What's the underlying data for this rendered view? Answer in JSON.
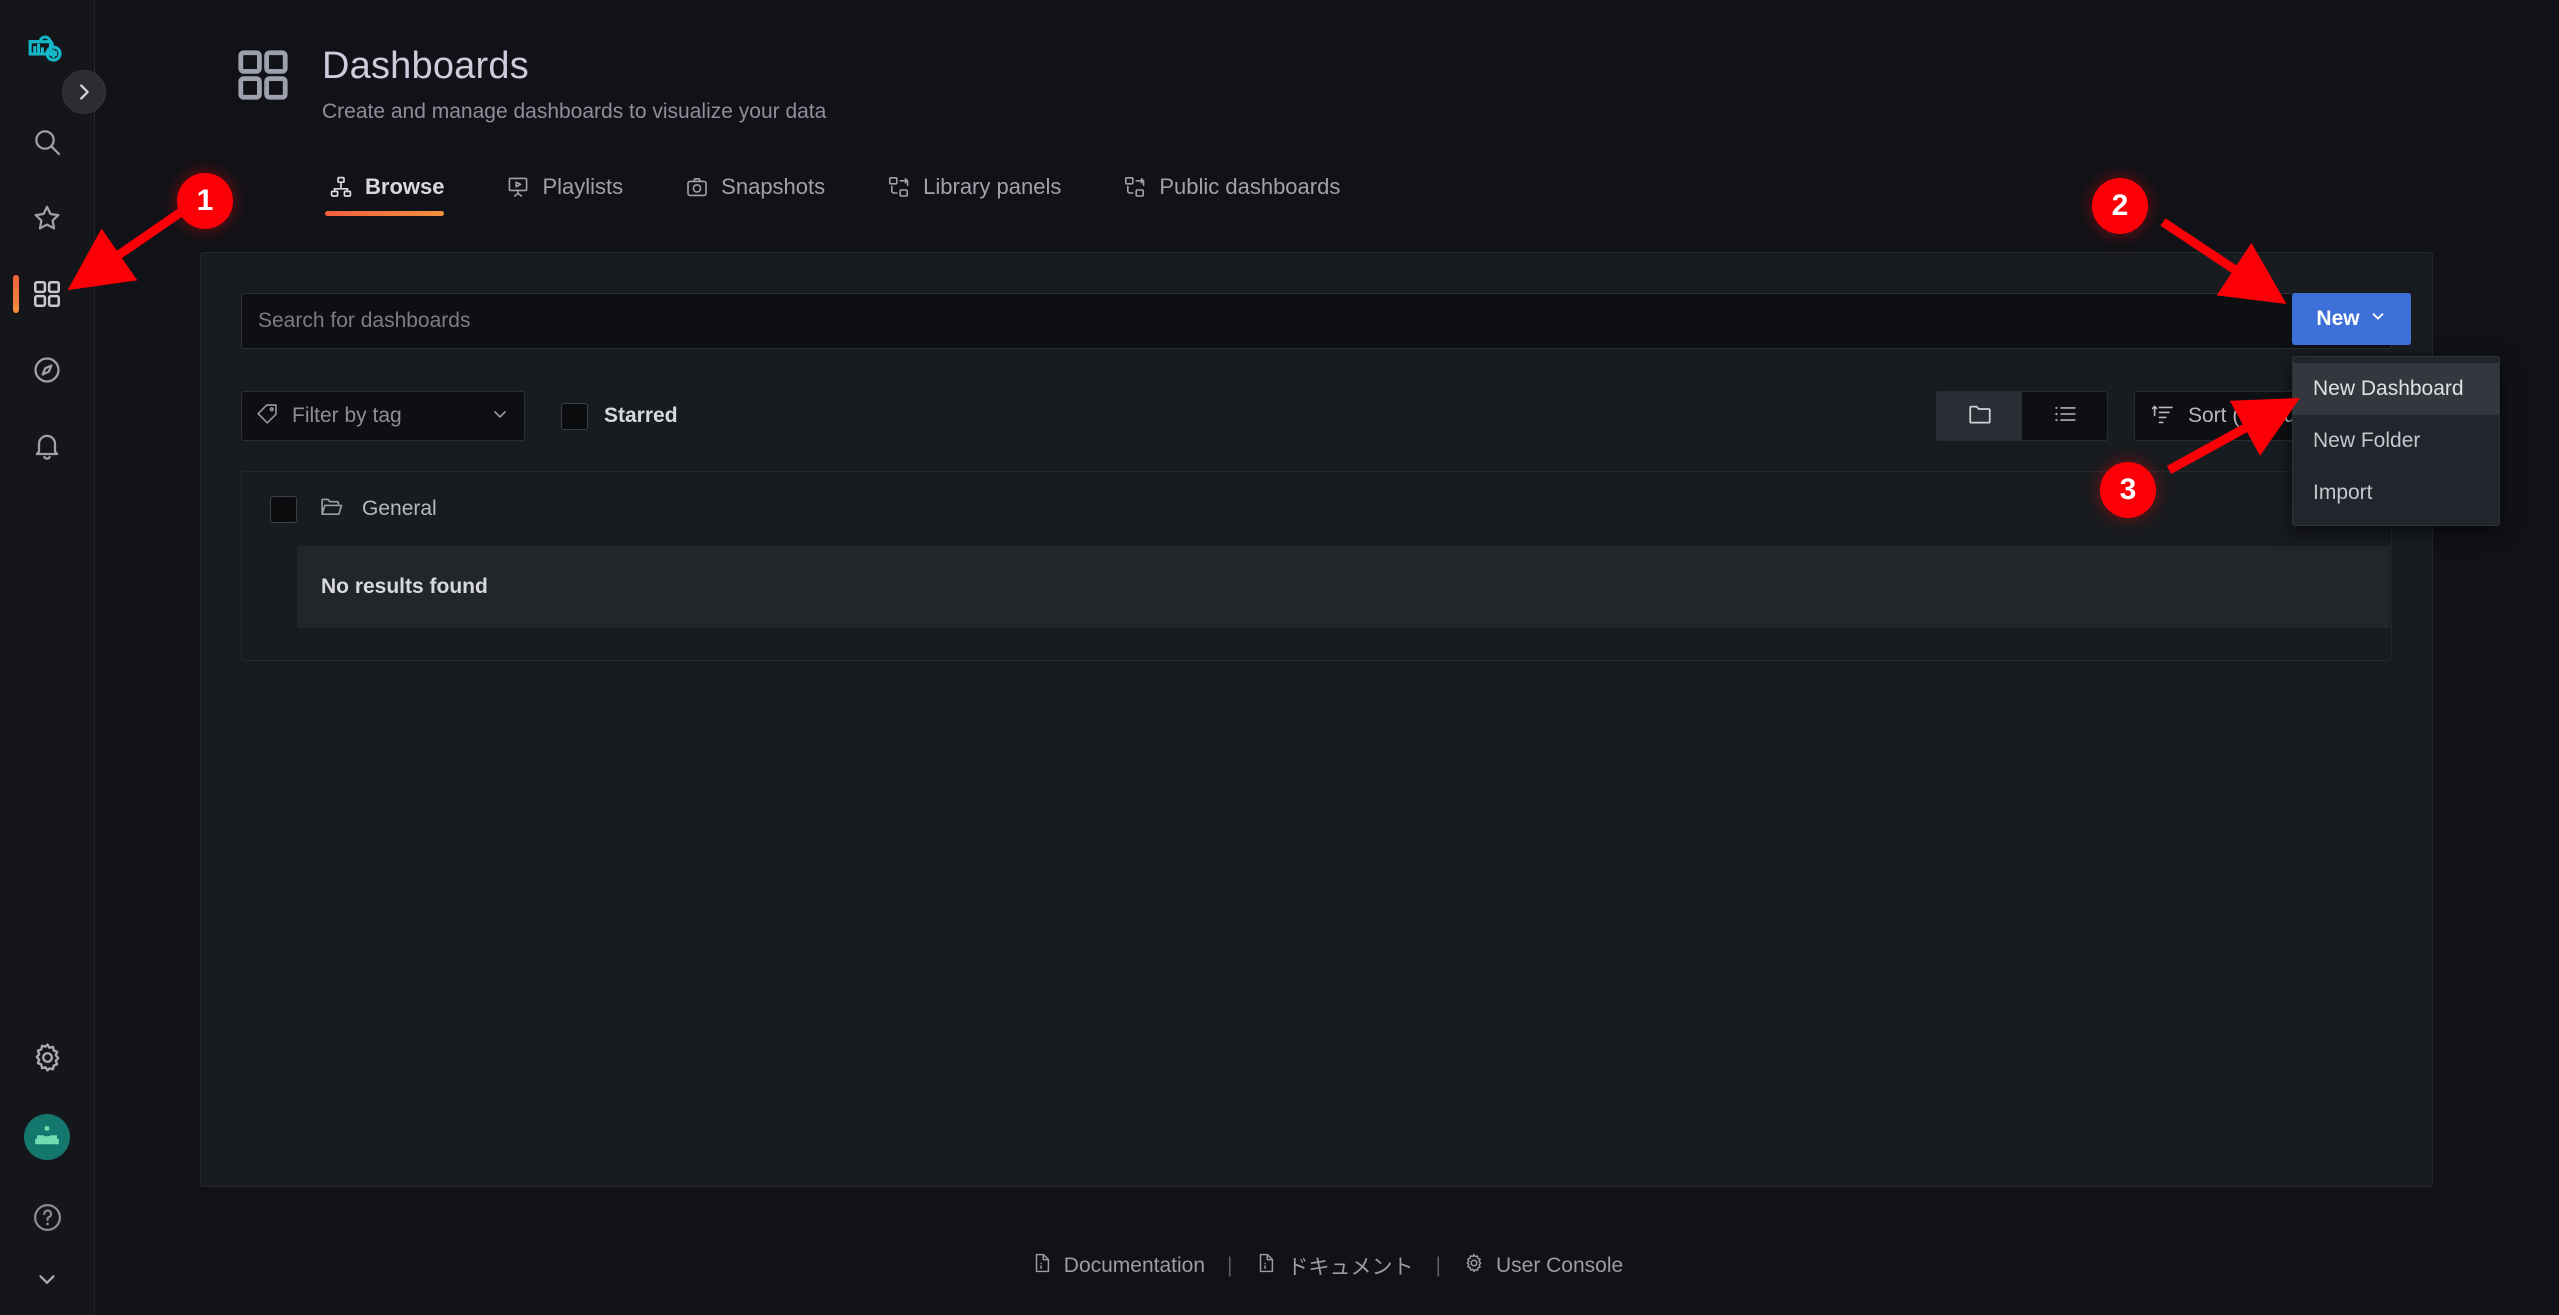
{
  "app": {
    "logo_icon": "grafana-cloud-logo-icon",
    "collapse_icon": "chevron-right-icon"
  },
  "sidebar": {
    "items": [
      {
        "name": "search",
        "icon": "search-icon",
        "active": false
      },
      {
        "name": "starred",
        "icon": "star-icon",
        "active": false
      },
      {
        "name": "dashboards",
        "icon": "dashboards-grid-icon",
        "active": true
      },
      {
        "name": "explore",
        "icon": "compass-icon",
        "active": false
      },
      {
        "name": "alerting",
        "icon": "bell-icon",
        "active": false
      }
    ],
    "bottom_items": [
      {
        "name": "configuration",
        "icon": "gear-icon"
      },
      {
        "name": "user-avatar",
        "icon": "avatar-robot-icon"
      },
      {
        "name": "help",
        "icon": "question-circle-icon"
      },
      {
        "name": "expand",
        "icon": "chevron-down-icon"
      }
    ]
  },
  "header": {
    "icon": "dashboards-grid-icon",
    "title": "Dashboards",
    "subtitle": "Create and manage dashboards to visualize your data"
  },
  "tabs": [
    {
      "label": "Browse",
      "icon": "sitemap-icon",
      "active": true
    },
    {
      "label": "Playlists",
      "icon": "presentation-play-icon",
      "active": false
    },
    {
      "label": "Snapshots",
      "icon": "camera-icon",
      "active": false
    },
    {
      "label": "Library panels",
      "icon": "library-panel-icon",
      "active": false
    },
    {
      "label": "Public dashboards",
      "icon": "library-panel-icon",
      "active": false
    }
  ],
  "search": {
    "placeholder": "Search for dashboards",
    "value": ""
  },
  "new_button": {
    "label": "New",
    "caret_icon": "chevron-down-icon",
    "color": "#3d71d9"
  },
  "new_menu": {
    "items": [
      {
        "label": "New Dashboard",
        "highlighted": true
      },
      {
        "label": "New Folder",
        "highlighted": false
      },
      {
        "label": "Import",
        "highlighted": false
      }
    ]
  },
  "filters": {
    "tag_filter": {
      "label": "Filter by tag",
      "icon": "tag-icon",
      "caret_icon": "chevron-down-icon"
    },
    "starred": {
      "label": "Starred",
      "checked": false
    },
    "view_toggle": {
      "folder_view_icon": "folder-icon",
      "flat_view_icon": "list-icon",
      "selected": "folder"
    },
    "sort": {
      "label": "Sort (Default A–Z)",
      "icon": "sort-amount-up-icon"
    }
  },
  "results": {
    "folder": {
      "name": "General",
      "icon": "folder-open-icon",
      "checked": false
    },
    "empty_message": "No results found"
  },
  "footer": {
    "links": [
      {
        "label": "Documentation",
        "icon": "file-doc-icon"
      },
      {
        "label": "ドキュメント",
        "icon": "file-doc-icon"
      },
      {
        "label": "User Console",
        "icon": "gear-icon"
      }
    ],
    "separator": "|"
  },
  "annotations": {
    "color": "#fb0007",
    "steps": [
      {
        "number": "1",
        "target": "sidebar-item-dashboards"
      },
      {
        "number": "2",
        "target": "new-button"
      },
      {
        "number": "3",
        "target": "new-dashboard-menu-item"
      }
    ]
  }
}
